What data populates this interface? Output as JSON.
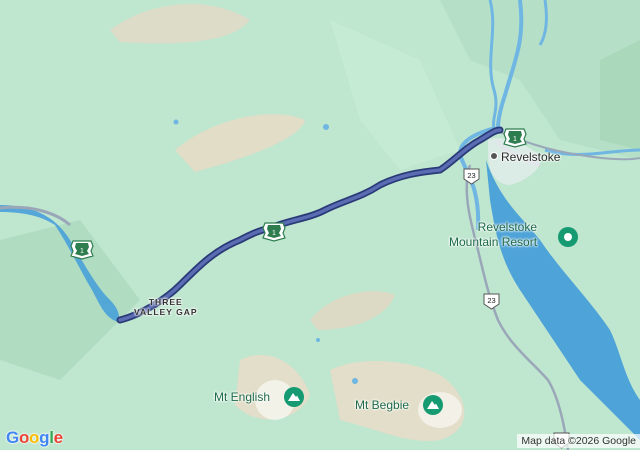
{
  "map": {
    "places": {
      "revelstoke": "Revelstoke",
      "three_valley_gap_line1": "THREE",
      "three_valley_gap_line2": "VALLEY GAP",
      "resort_line1": "Revelstoke",
      "resort_line2": "Mountain Resort",
      "mt_english": "Mt English",
      "mt_begbie": "Mt Begbie"
    },
    "highway_shields": {
      "trans_canada": "1",
      "hwy_23": "23"
    },
    "attribution": "Map data ©2026 Google",
    "logo": "Google",
    "colors": {
      "land": "#bfe6cf",
      "water": "#4ea3d8",
      "route": "#4f5fa0",
      "route_outline": "#2a3a78",
      "road": "#9aa7b8",
      "poi": "#159a72",
      "shield_green": "#2e7d4f"
    }
  }
}
